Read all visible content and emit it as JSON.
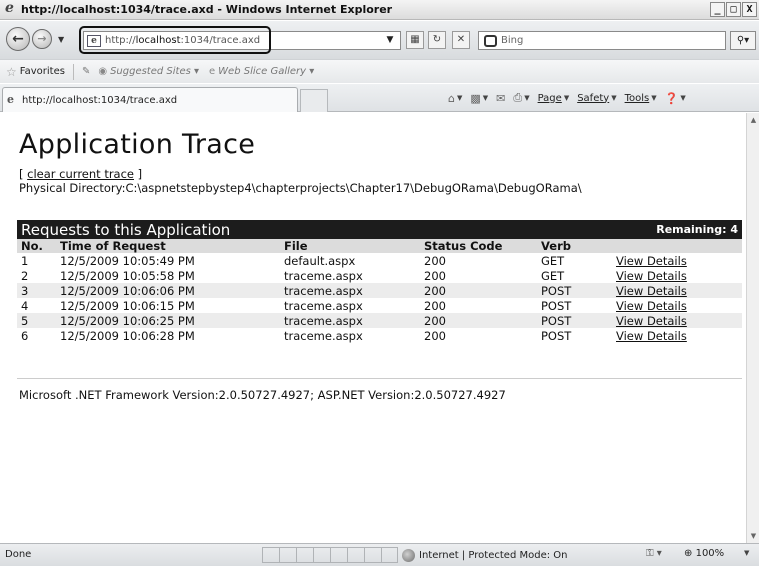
{
  "window": {
    "title": "http://localhost:1034/trace.axd - Windows Internet Explorer",
    "controls": [
      "_",
      "□",
      "X"
    ]
  },
  "address": {
    "url_prefix": "http://",
    "url_host": "localhost",
    "url_rest": ":1034/trace.axd",
    "search_placeholder": "Bing"
  },
  "favorites_bar": {
    "label": "Favorites",
    "items": [
      "Suggested Sites ▾",
      "Web Slice Gallery ▾"
    ]
  },
  "tab": {
    "title": "http://localhost:1034/trace.axd"
  },
  "command_bar": {
    "page": "Page",
    "safety": "Safety",
    "tools": "Tools"
  },
  "page": {
    "heading": "Application Trace",
    "clear_prefix": "[ ",
    "clear_link": "clear current trace",
    "clear_suffix": " ]",
    "physical_directory_label": "Physical Directory:",
    "physical_directory": "C:\\aspnetstepbystep4\\chapterprojects\\Chapter17\\DebugORama\\DebugORama\\",
    "requests_title": "Requests to this Application",
    "remaining": "Remaining: 4",
    "columns": [
      "No.",
      "Time of Request",
      "File",
      "Status Code",
      "Verb",
      ""
    ],
    "rows": [
      {
        "no": "1",
        "time": "12/5/2009 10:05:49 PM",
        "file": "default.aspx",
        "status": "200",
        "verb": "GET",
        "link": "View Details"
      },
      {
        "no": "2",
        "time": "12/5/2009 10:05:58 PM",
        "file": "traceme.aspx",
        "status": "200",
        "verb": "GET",
        "link": "View Details"
      },
      {
        "no": "3",
        "time": "12/5/2009 10:06:06 PM",
        "file": "traceme.aspx",
        "status": "200",
        "verb": "POST",
        "link": "View Details"
      },
      {
        "no": "4",
        "time": "12/5/2009 10:06:15 PM",
        "file": "traceme.aspx",
        "status": "200",
        "verb": "POST",
        "link": "View Details"
      },
      {
        "no": "5",
        "time": "12/5/2009 10:06:25 PM",
        "file": "traceme.aspx",
        "status": "200",
        "verb": "POST",
        "link": "View Details"
      },
      {
        "no": "6",
        "time": "12/5/2009 10:06:28 PM",
        "file": "traceme.aspx",
        "status": "200",
        "verb": "POST",
        "link": "View Details"
      }
    ],
    "version": "Microsoft .NET Framework Version:2.0.50727.4927; ASP.NET Version:2.0.50727.4927"
  },
  "status_bar": {
    "text": "Done",
    "zone": "Internet | Protected Mode: On",
    "zoom": "100%"
  }
}
